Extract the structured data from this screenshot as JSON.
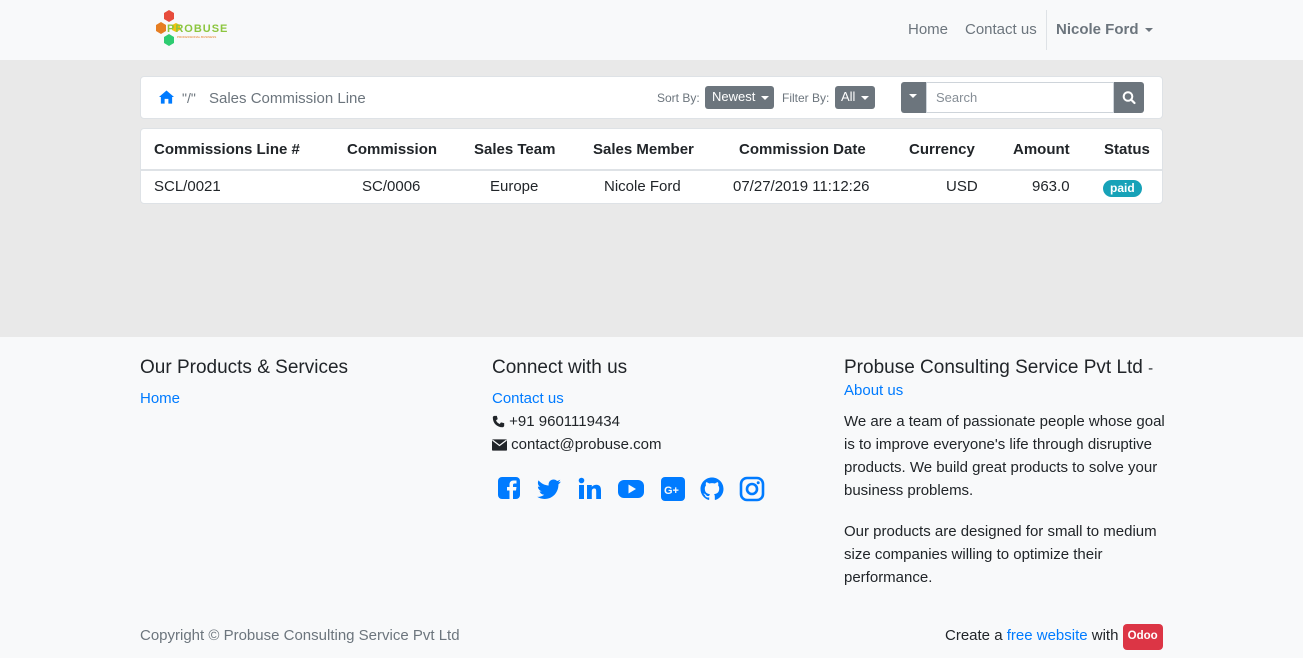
{
  "navbar": {
    "logo_text": "PROBUSE",
    "logo_subtext": "PROFESSIONAL BUSINESS",
    "home": "Home",
    "contact": "Contact us",
    "user": "Nicole Ford"
  },
  "breadcrumb": {
    "separator": "\"/\"",
    "current": "Sales Commission Line"
  },
  "toolbar": {
    "sort_label": "Sort By:",
    "sort_value": "Newest",
    "filter_label": "Filter By:",
    "filter_value": "All",
    "search_placeholder": "Search"
  },
  "table": {
    "headers": [
      "Commissions Line #",
      "Commission",
      "Sales Team",
      "Sales Member",
      "Commission Date",
      "Currency",
      "Amount",
      "Status"
    ],
    "rows": [
      {
        "line": "SCL/0021",
        "commission": "SC/0006",
        "team": "Europe",
        "member": "Nicole Ford",
        "date": "07/27/2019 11:12:26",
        "currency": "USD",
        "amount": "963.0",
        "status": "paid"
      }
    ]
  },
  "footer": {
    "products_title": "Our Products & Services",
    "products_home": "Home",
    "connect_title": "Connect with us",
    "contact_link": "Contact us",
    "phone": "+91 9601119434",
    "email": "contact@probuse.com",
    "social_icons": [
      "facebook-icon",
      "twitter-icon",
      "linkedin-icon",
      "youtube-icon",
      "google-plus-icon",
      "github-icon",
      "instagram-icon"
    ],
    "company_title": "Probuse Consulting Service Pvt Ltd",
    "company_dash": "-",
    "about_link": "About us",
    "about_p1": "We are a team of passionate people whose goal is to improve everyone's life through disruptive products. We build great products to solve your business problems.",
    "about_p2": "Our products are designed for small to medium size companies willing to optimize their performance.",
    "copyright": "Copyright © Probuse Consulting Service Pvt Ltd",
    "create_text": "Create a",
    "free_website": "free website",
    "with_text": "with",
    "odoo": "Odoo"
  },
  "colors": {
    "link": "#007bff",
    "secondary_button": "#6c757d",
    "badge_paid": "#17a2b8",
    "odoo_badge": "#dc3545"
  }
}
